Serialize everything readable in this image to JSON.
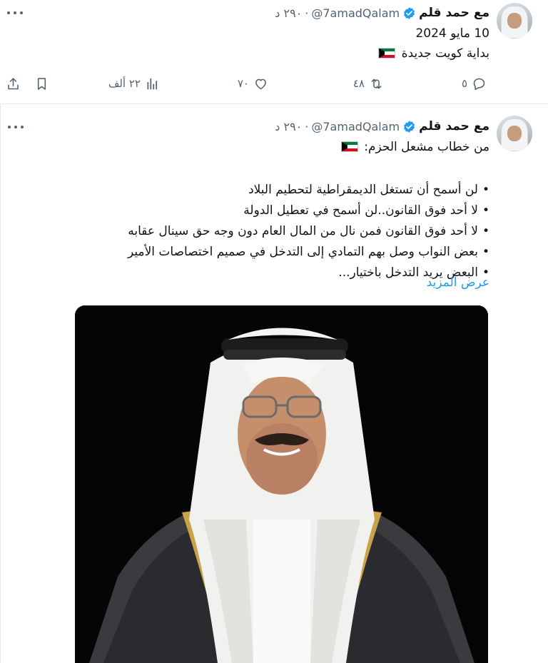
{
  "tweets": [
    {
      "author_name": "مع حمد قلم",
      "handle": "@7amadQalam",
      "time": "٢٩٠ د",
      "date_line": "10 مايو 2024",
      "text": "بداية كويت جديدة",
      "stats": {
        "replies": "٥",
        "retweets": "٤٨",
        "likes": "٧٠",
        "views": "٢٢ ألف"
      }
    },
    {
      "author_name": "مع حمد قلم",
      "handle": "@7amadQalam",
      "time": "٢٩٠ د",
      "intro": "من خطاب مشعل الحزم:",
      "bullets": [
        "لن أسمح أن تستغل الديمقراطية لتحطيم البلاد",
        "لا أحد فوق القانون..لن أسمح في تعطيل الدولة",
        "لا أحد فوق القانون فمن نال من المال العام دون وجه حق سينال عقابه",
        "بعض النواب وصل بهم التمادي إلى التدخل في صميم اختصاصات الأمير",
        "البعض يريد التدخل باختيار..."
      ],
      "show_more": "عرض المزيد"
    }
  ],
  "icons": {
    "verified": "verified-badge-icon",
    "more": "more-icon",
    "reply": "reply-icon",
    "retweet": "retweet-icon",
    "like": "heart-icon",
    "views": "views-icon",
    "bookmark": "bookmark-icon",
    "share": "share-icon",
    "flag": "kuwait-flag-icon"
  },
  "colors": {
    "accent": "#1d9bf0",
    "muted": "#536471",
    "text": "#0f1419"
  }
}
